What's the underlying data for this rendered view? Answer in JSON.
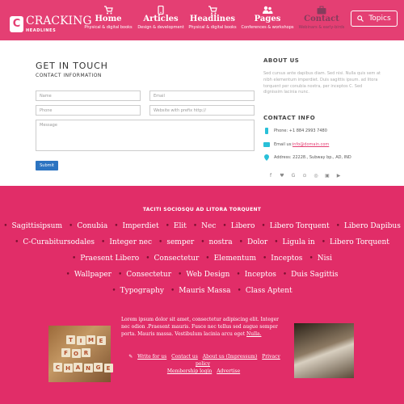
{
  "header": {
    "logo_letter": "C",
    "logo_main": "CRACKING",
    "logo_sub": "HEADLINES",
    "nav": [
      {
        "label": "Home",
        "sub": "Physical & digital books",
        "icon": "cart-icon"
      },
      {
        "label": "Articles",
        "sub": "Design & development",
        "icon": "phone-icon"
      },
      {
        "label": "Headlines",
        "sub": "Physical & digital books",
        "icon": "cart-icon"
      },
      {
        "label": "Pages",
        "sub": "Conferences & workshops",
        "icon": "people-icon"
      },
      {
        "label": "Contact",
        "sub": "Webinars & early-birds",
        "icon": "briefcase-icon"
      }
    ],
    "topics_label": "Topics"
  },
  "contact_form": {
    "title": "GET IN TOUCH",
    "subtitle": "CONTACT INFORMATION",
    "name_placeholder": "Name",
    "email_placeholder": "Email",
    "phone_placeholder": "Phone",
    "website_placeholder": "Website with prefix http://",
    "message_placeholder": "Message",
    "submit_label": "Submit"
  },
  "about": {
    "title": "ABOUT US",
    "text": "Sed cursus ante dapibus diam. Sed nisi. Nulla quis sem at nibh elementum imperdiet. Duis sagittis ipsum. ad litora torquent per conubia nostra, per inceptos C. Sed dignissim lacinia nunc."
  },
  "contact_info": {
    "title": "CONTACT INFO",
    "phone": "Phone: +1 884 2993 7480",
    "email_prefix": "Email us:",
    "email": "info@domain.com",
    "address": "Address: 22228., Subway bp., AD, IND"
  },
  "socials": [
    "facebook-icon",
    "twitter-icon",
    "google-icon",
    "pinterest-icon",
    "instagram-icon",
    "linkedin-icon",
    "youtube-icon"
  ],
  "tags": {
    "title": "TACITI SOCIOSQU AD LITORA TORQUENT",
    "rows": [
      [
        "Sagittisipsum",
        "Conubia",
        "Imperdiet",
        "Elit",
        "Nec",
        "Libero",
        "Libero Torquent",
        "Libero Dapibus"
      ],
      [
        "C-Curabitursodales",
        "Integer nec",
        "semper",
        "nostra",
        "Dolor",
        "Ligula in",
        "Libero Torquent"
      ],
      [
        "Praesent Libero",
        "Consectetur",
        "Elementum",
        "Inceptos",
        "Nisi"
      ],
      [
        "Wallpaper",
        "Consectetur",
        "Web Design",
        "Inceptos",
        "Duis Sagittis"
      ],
      [
        "Typography",
        "Mauris Massa",
        "Class Aptent"
      ]
    ]
  },
  "footer": {
    "lorem": "Lorem ipsum dolor sit amet, consectetur adipiscing elit. Integer nec odion .Praesent mauris. Fusce nec tellus sed augue semper porta. Mauris massa. Vestibulum lacinia arcu eget",
    "lorem_link": "Nulla.",
    "links": [
      "Write for us",
      "Contact us",
      "About us (Impressum)",
      "Privacy policy",
      "Membership login",
      "Advertise"
    ],
    "tiles_1": [
      "T",
      "I",
      "M",
      "E"
    ],
    "tiles_2": [
      "F",
      "O",
      "R"
    ],
    "tiles_3": [
      "C",
      "H",
      "A",
      "N",
      "G",
      "E"
    ]
  }
}
